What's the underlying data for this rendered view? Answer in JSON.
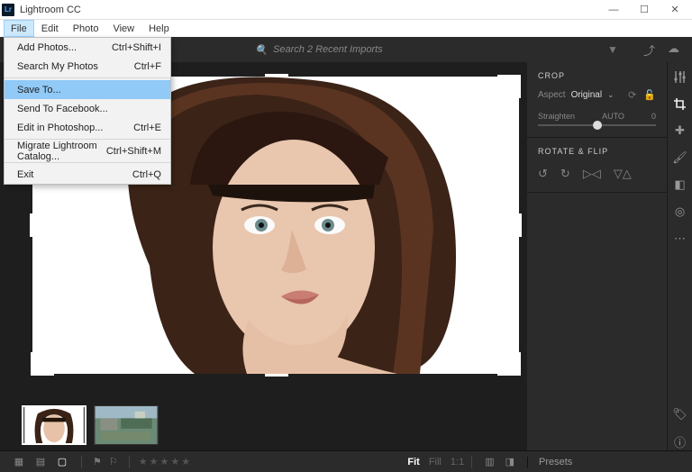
{
  "window": {
    "title": "Lightroom CC"
  },
  "menubar": [
    "File",
    "Edit",
    "Photo",
    "View",
    "Help"
  ],
  "file_menu": [
    {
      "label": "Add Photos...",
      "shortcut": "Ctrl+Shift+I"
    },
    {
      "label": "Search My Photos",
      "shortcut": "Ctrl+F"
    },
    {
      "sep": true
    },
    {
      "label": "Save To...",
      "shortcut": "",
      "selected": true
    },
    {
      "label": "Send To Facebook...",
      "shortcut": ""
    },
    {
      "label": "Edit in Photoshop...",
      "shortcut": "Ctrl+E"
    },
    {
      "sep": true
    },
    {
      "label": "Migrate Lightroom Catalog...",
      "shortcut": "Ctrl+Shift+M"
    },
    {
      "sep": true
    },
    {
      "label": "Exit",
      "shortcut": "Ctrl+Q"
    }
  ],
  "toolbar": {
    "search_placeholder": "Search 2 Recent Imports"
  },
  "crop_panel": {
    "title": "CROP",
    "aspect_label": "Aspect",
    "aspect_value": "Original",
    "straighten_label": "Straighten",
    "auto_label": "AUTO",
    "straighten_value": "0"
  },
  "rotate_panel": {
    "title": "ROTATE & FLIP"
  },
  "bottom": {
    "fit": "Fit",
    "fill": "Fill",
    "oneToOne": "1:1",
    "presets": "Presets"
  }
}
